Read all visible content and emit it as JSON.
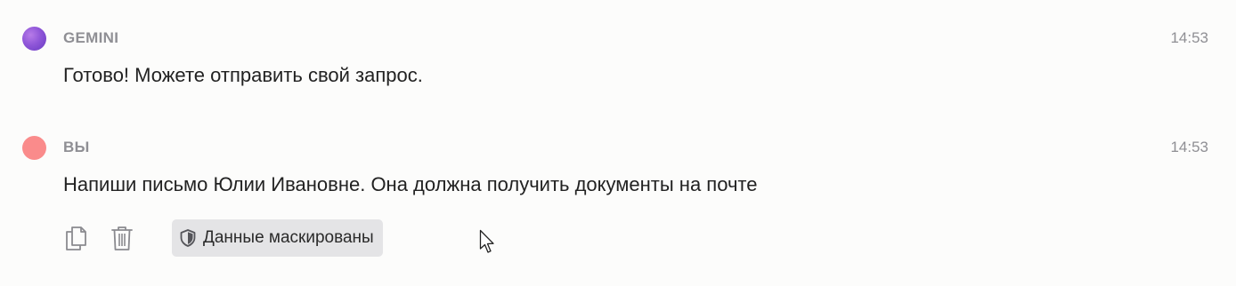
{
  "messages": [
    {
      "sender": "GEMINI",
      "time": "14:53",
      "text": "Готово! Можете отправить свой запрос."
    },
    {
      "sender": "ВЫ",
      "time": "14:53",
      "text": "Напиши письмо Юлии Ивановне. Она должна получить документы на почте"
    }
  ],
  "actions": {
    "copy_icon": "copy-icon",
    "delete_icon": "trash-icon",
    "masked_label": "Данные маскированы",
    "masked_icon": "shield-icon"
  },
  "colors": {
    "gemini_avatar": "#8f56d8",
    "user_avatar": "#fa8b8b",
    "meta_text": "#8f8f94",
    "badge_bg": "#e4e4e6"
  }
}
